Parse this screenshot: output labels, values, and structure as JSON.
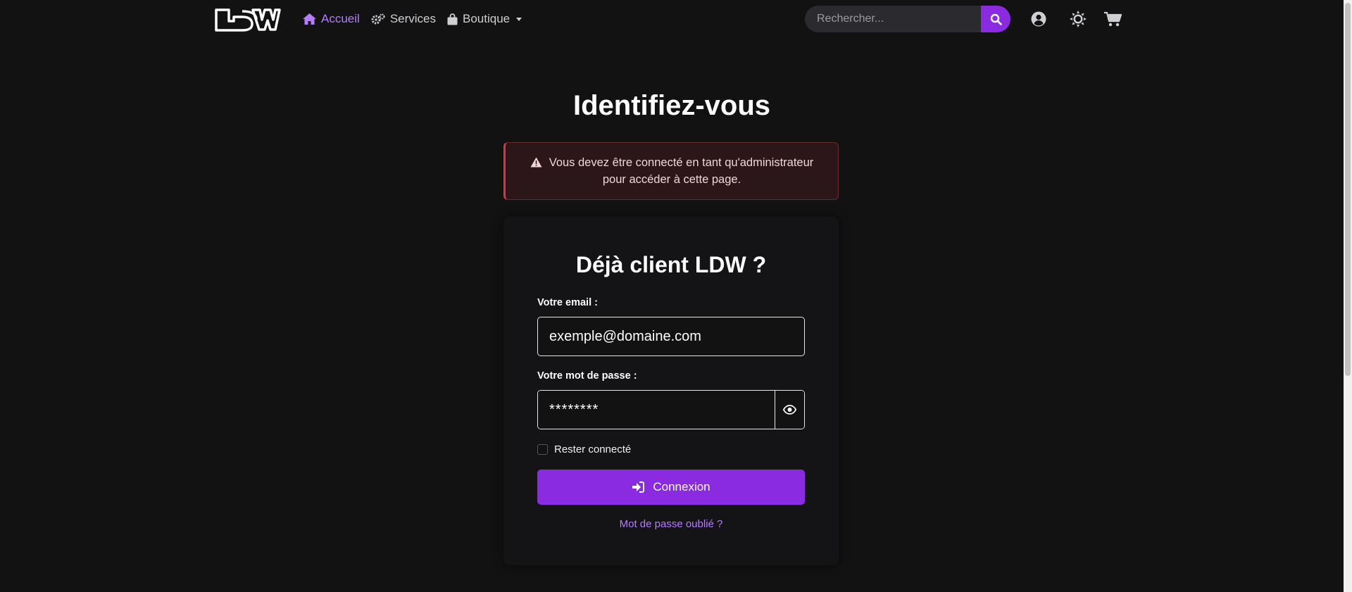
{
  "brand": {
    "logo_alt": "LDW"
  },
  "nav": {
    "items": [
      {
        "label": "Accueil",
        "icon": "home-icon",
        "active": true
      },
      {
        "label": "Services",
        "icon": "gears-icon",
        "active": false
      },
      {
        "label": "Boutique",
        "icon": "shopping-bag-icon",
        "active": false,
        "dropdown": true
      }
    ]
  },
  "search": {
    "placeholder": "Rechercher...",
    "value": ""
  },
  "header_icons": [
    "user-circle-icon",
    "sun-icon",
    "cart-icon"
  ],
  "page": {
    "title": "Identifiez-vous"
  },
  "alert": {
    "line1": "Vous devez être connecté en tant qu'administrateur",
    "line2": "pour accéder à cette page."
  },
  "login": {
    "title": "Déjà client LDW ?",
    "email_label": "Votre email :",
    "email_value": "exemple@domaine.com",
    "password_label": "Votre mot de passe :",
    "password_value": "********",
    "remember_label": "Rester connecté",
    "remember_checked": false,
    "submit_label": "Connexion",
    "forgot_label": "Mot de passe oublié ?"
  },
  "colors": {
    "accent": "#8a2be2",
    "accent_text": "#b57cff",
    "background": "#121213",
    "alert_border": "#dc3545"
  }
}
